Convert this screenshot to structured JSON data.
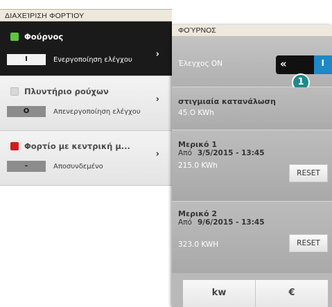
{
  "left_panel": {
    "title": "ΔΙΑΧΕΊΡΙΣΗ ΦΟΡΤΊΟΥ",
    "loads": [
      {
        "name": "Φούρνος",
        "badge": "I",
        "status": "Ενεργοποίηση ελέγχου",
        "dot_color": "#5cc63c"
      },
      {
        "name": "Πλυντήριο ρούχων",
        "badge": "O",
        "status": "Απενεργοποίηση ελέγχου",
        "dot_color": "#d8d8d8"
      },
      {
        "name": "Φορτίο με κεντρική μ...",
        "badge": "-",
        "status": "Αποσυνδεμένο",
        "dot_color": "#d51c1c"
      }
    ],
    "chevron": "›"
  },
  "right_panel": {
    "title": "ΦΟΎΡΝΟΣ",
    "control": {
      "label": "Έλεγχος ON",
      "arrows": "«",
      "toggle_text": "I",
      "callout": "1"
    },
    "instant": {
      "heading": "στιγμιαία κατανάλωση",
      "value": "45.O KWh"
    },
    "partial1": {
      "heading": "Μερικό 1",
      "from": "Από",
      "date": "3/5/2015 - 13:45",
      "value": "215.0 KWh",
      "reset": "RESET"
    },
    "partial2": {
      "heading": "Μερικό 2",
      "from": "Από",
      "date": "9/6/2015 - 13:45",
      "value": "323.0 KWH",
      "reset": "RESET"
    },
    "units": [
      "kw",
      "€"
    ]
  },
  "colors": {
    "accent_blue": "#1e88c8",
    "callout_teal": "#1f8a8a",
    "title_bar": "#efe8dc"
  }
}
